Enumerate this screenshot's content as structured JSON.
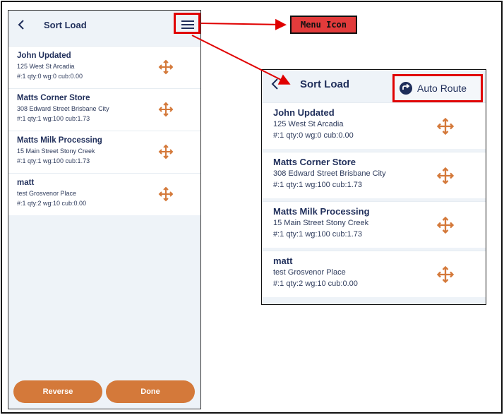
{
  "left_screen": {
    "header": {
      "title": "Sort Load"
    },
    "items": [
      {
        "name": "John Updated",
        "address": "125 West St Arcadia",
        "meta": "#:1 qty:0 wg:0 cub:0.00"
      },
      {
        "name": "Matts Corner Store",
        "address": "308 Edward Street Brisbane City",
        "meta": "#:1 qty:1 wg:100 cub:1.73"
      },
      {
        "name": "Matts Milk Processing",
        "address": "15 Main Street Stony Creek",
        "meta": "#:1 qty:1 wg:100 cub:1.73"
      },
      {
        "name": "matt",
        "address": "test Grosvenor Place",
        "meta": "#:1 qty:2 wg:10 cub:0.00"
      }
    ],
    "buttons": {
      "reverse": "Reverse",
      "done": "Done"
    }
  },
  "right_screen": {
    "header": {
      "title": "Sort Load"
    },
    "menu": {
      "auto_route": "Auto Route"
    },
    "items": [
      {
        "name": "John Updated",
        "address": "125 West St Arcadia",
        "meta": "#:1 qty:0 wg:0 cub:0.00"
      },
      {
        "name": "Matts Corner Store",
        "address": "308 Edward Street Brisbane City",
        "meta": "#:1 qty:1 wg:100 cub:1.73"
      },
      {
        "name": "Matts Milk Processing",
        "address": "15 Main Street Stony Creek",
        "meta": "#:1 qty:1 wg:100 cub:1.73"
      },
      {
        "name": "matt",
        "address": "test Grosvenor Place",
        "meta": "#:1 qty:2 wg:10 cub:0.00"
      }
    ]
  },
  "annotation": {
    "label": "Menu Icon"
  },
  "colors": {
    "accent": "#d4793a",
    "callout": "#e00000",
    "text": "#1f2e5a",
    "background": "#eef3f8"
  },
  "icons": {
    "back": "chevron-left-icon",
    "menu": "hamburger-menu-icon",
    "drag": "move-arrows-icon",
    "auto_route": "route-circle-icon"
  }
}
